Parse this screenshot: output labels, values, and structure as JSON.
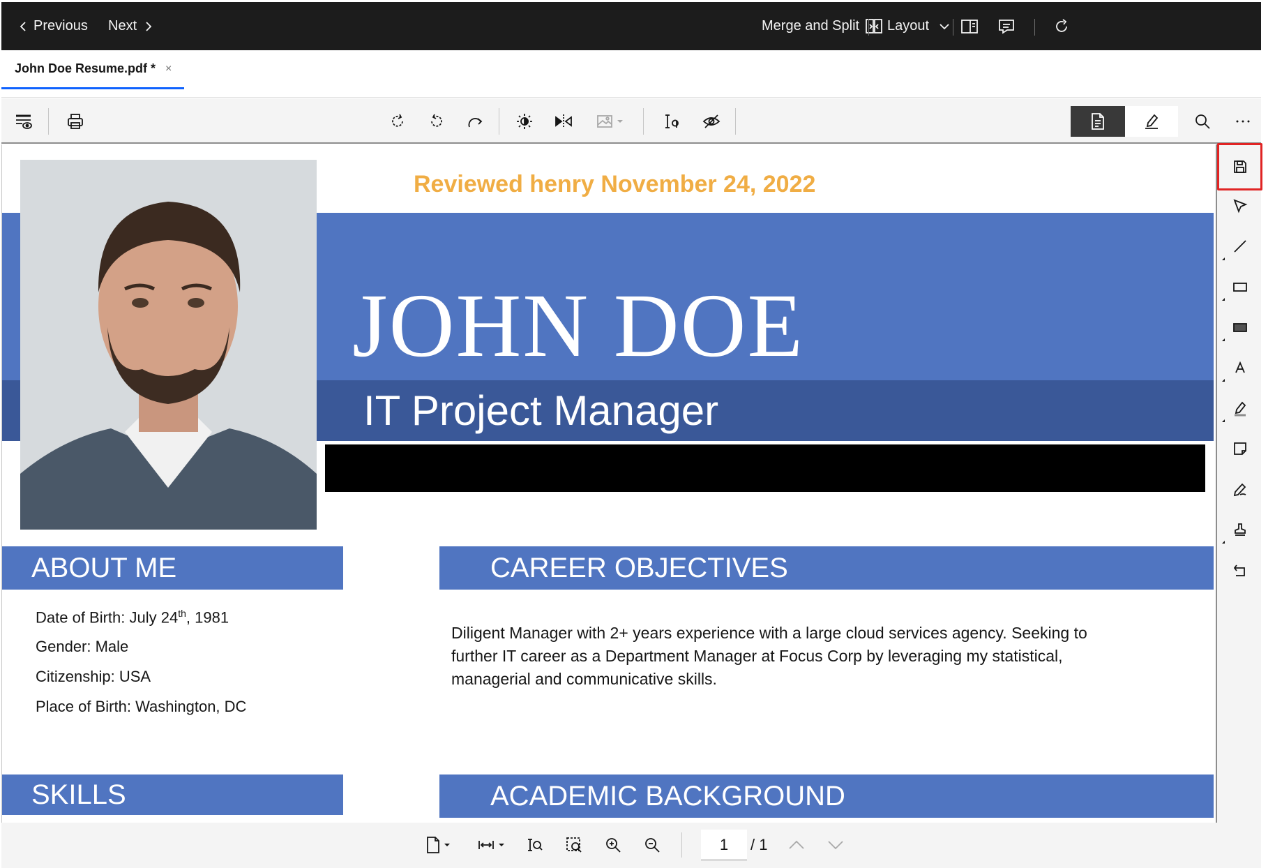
{
  "topbar": {
    "previous_label": "Previous",
    "next_label": "Next",
    "merge_split_label": "Merge and Split",
    "layout_label": "Layout"
  },
  "tab": {
    "label": "John Doe Resume.pdf *",
    "close": "×"
  },
  "document": {
    "reviewed_stamp": "Reviewed henry November 24, 2022",
    "name": "JOHN DOE",
    "role": "IT Project Manager",
    "about_header": "ABOUT ME",
    "about": {
      "dob_prefix": "Date of Birth: July 24",
      "dob_sup": "th",
      "dob_suffix": ", 1981",
      "gender": "Gender: Male",
      "citizenship": "Citizenship: USA",
      "birthplace": "Place of Birth: Washington, DC"
    },
    "career_header": "CAREER OBJECTIVES",
    "career_text": "Diligent Manager with 2+ years experience with a large cloud services agency. Seeking to further IT career as a Department Manager at Focus Corp  by leveraging my statistical, managerial and communicative skills.",
    "skills_header": "SKILLS",
    "academic_header": "ACADEMIC BACKGROUND"
  },
  "pagination": {
    "current_page": "1",
    "total": "/ 1"
  },
  "colors": {
    "accent_blue": "#5075c1",
    "dark_blue": "#3a5898",
    "reviewed_orange": "#f0ad44",
    "highlight_red": "#e02424",
    "topbar_bg": "#1c1c1c"
  }
}
